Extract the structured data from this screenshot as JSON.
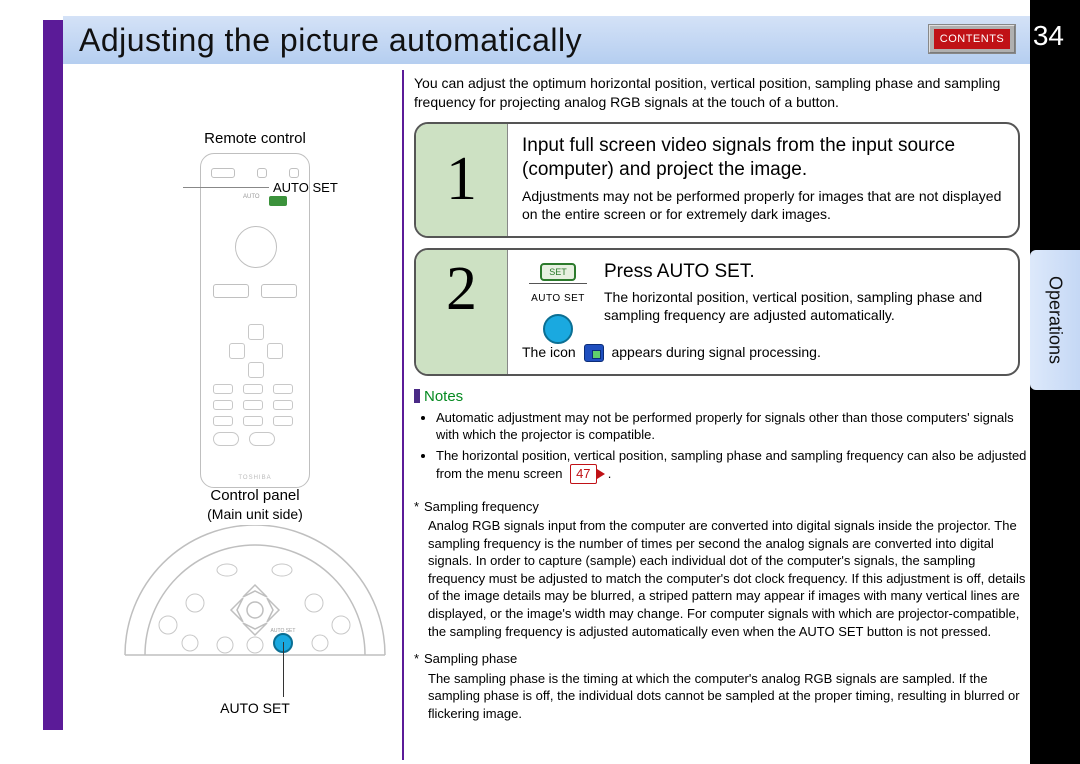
{
  "header": {
    "title": "Adjusting the picture automatically",
    "contents_label": "CONTENTS",
    "page_number": "34"
  },
  "side_tab": "Operations",
  "left": {
    "remote_label": "Remote control",
    "auto_set_callout": "AUTO SET",
    "remote_brand": "TOSHIBA",
    "remote_auto_tiny": "AUTO",
    "control_panel_label": "Control panel",
    "main_unit_side": "(Main unit side)",
    "panel_autoset": "AUTO SET"
  },
  "intro": "You can adjust the optimum horizontal position, vertical position, sampling phase and sampling frequency for projecting analog RGB signals at the touch of a button.",
  "steps": [
    {
      "num": "1",
      "title": "Input full screen video signals from the input source (computer) and project the image.",
      "text": "Adjustments may not be performed properly for images that are not displayed on the entire screen or for extremely dark images."
    },
    {
      "num": "2",
      "title": "Press AUTO SET.",
      "set_chip": "SET",
      "autoset_tiny": "AUTO SET",
      "text": "The horizontal position, vertical position, sampling phase and sampling frequency are adjusted automatically.",
      "icon_prefix": "The icon",
      "icon_suffix": "appears during signal processing."
    }
  ],
  "notes": {
    "heading": "Notes",
    "bullets": [
      "Automatic adjustment may not be performed properly for signals other than those computers' signals with which the projector is compatible.",
      "The horizontal position, vertical position, sampling phase and sampling frequency can also be adjusted from the menu screen"
    ],
    "ref": "47",
    "period": "."
  },
  "definitions": [
    {
      "term": "Sampling frequency",
      "body": "Analog RGB signals input from the computer are converted into digital signals inside the projector. The sampling frequency is the number of times per second the analog signals are converted into digital signals. In order to capture (sample) each individual dot of the computer's signals, the sampling frequency must be adjusted to match the computer's dot clock frequency. If this adjustment is off, details of the image details may be blurred, a striped pattern may appear if images with many vertical lines are displayed, or the image's width may change. For computer signals with which are projector-compatible, the sampling frequency is adjusted automatically even when the AUTO SET button is not pressed."
    },
    {
      "term": "Sampling phase",
      "body": "The sampling phase is the timing at which the computer's analog RGB signals are sampled. If the sampling phase is off, the individual dots cannot be sampled at the proper timing, resulting in blurred or flickering image."
    }
  ]
}
